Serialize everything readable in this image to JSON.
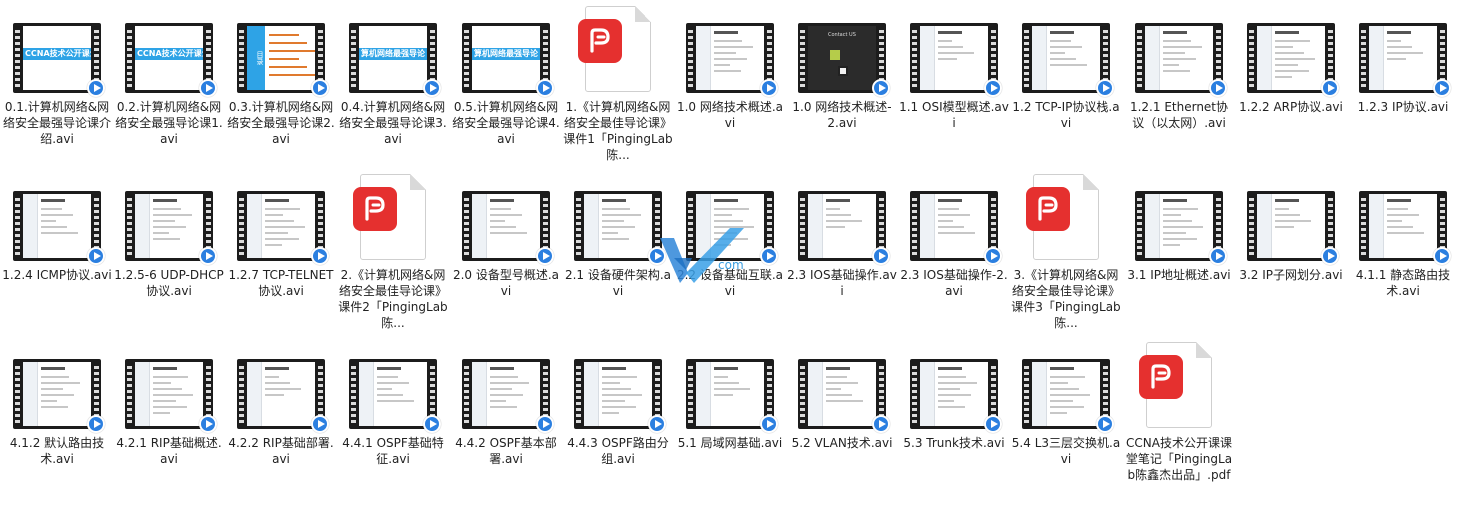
{
  "files": [
    {
      "name": "0.1.计算机网络&网络安全最强导论课介绍.avi",
      "kind": "video",
      "preview": "banner",
      "banner": "CCNA技术公开课介绍"
    },
    {
      "name": "0.2.计算机网络&网络安全最强导论课1.avi",
      "kind": "video",
      "preview": "banner",
      "banner": "CCNA技术公开课介绍"
    },
    {
      "name": "0.3.计算机网络&网络安全最强导论课2.avi",
      "kind": "video",
      "preview": "menu",
      "banner": "目录"
    },
    {
      "name": "0.4.计算机网络&网络安全最强导论课3.avi",
      "kind": "video",
      "preview": "banner",
      "banner": "算机网络最强导论（"
    },
    {
      "name": "0.5.计算机网络&网络安全最强导论课4.avi",
      "kind": "video",
      "preview": "banner",
      "banner": "算机网络最强导论（"
    },
    {
      "name": "1.《计算机网络&网络安全最佳导论课》课件1「PingingLab陈...",
      "kind": "pdf"
    },
    {
      "name": "1.0 网络技术概述.avi",
      "kind": "video",
      "preview": "doc"
    },
    {
      "name": "1.0 网络技术概述-2.avi",
      "kind": "video",
      "preview": "dark",
      "banner": "Contact US"
    },
    {
      "name": "1.1 OSI模型概述.avi",
      "kind": "video",
      "preview": "doc"
    },
    {
      "name": "1.2 TCP-IP协议栈.avi",
      "kind": "video",
      "preview": "doc"
    },
    {
      "name": "1.2.1 Ethernet协议（以太网）.avi",
      "kind": "video",
      "preview": "doc"
    },
    {
      "name": "1.2.2 ARP协议.avi",
      "kind": "video",
      "preview": "doc"
    },
    {
      "name": "1.2.3 IP协议.avi",
      "kind": "video",
      "preview": "doc"
    },
    {
      "name": "1.2.4 ICMP协议.avi",
      "kind": "video",
      "preview": "doc"
    },
    {
      "name": "1.2.5-6 UDP-DHCP协议.avi",
      "kind": "video",
      "preview": "doc"
    },
    {
      "name": "1.2.7 TCP-TELNET协议.avi",
      "kind": "video",
      "preview": "doc"
    },
    {
      "name": "2.《计算机网络&网络安全最佳导论课》课件2「PingingLab陈...",
      "kind": "pdf"
    },
    {
      "name": "2.0 设备型号概述.avi",
      "kind": "video",
      "preview": "doc"
    },
    {
      "name": "2.1 设备硬件架构.avi",
      "kind": "video",
      "preview": "doc"
    },
    {
      "name": "2.2 设备基础互联.avi",
      "kind": "video",
      "preview": "doc"
    },
    {
      "name": "2.3 IOS基础操作.avi",
      "kind": "video",
      "preview": "doc"
    },
    {
      "name": "2.3 IOS基础操作-2.avi",
      "kind": "video",
      "preview": "doc"
    },
    {
      "name": "3.《计算机网络&网络安全最佳导论课》课件3「PingingLab陈...",
      "kind": "pdf"
    },
    {
      "name": "3.1 IP地址概述.avi",
      "kind": "video",
      "preview": "doc"
    },
    {
      "name": "3.2 IP子网划分.avi",
      "kind": "video",
      "preview": "doc"
    },
    {
      "name": "4.1.1 静态路由技术.avi",
      "kind": "video",
      "preview": "doc"
    },
    {
      "name": "4.1.2 默认路由技术.avi",
      "kind": "video",
      "preview": "doc"
    },
    {
      "name": "4.2.1 RIP基础概述.avi",
      "kind": "video",
      "preview": "doc"
    },
    {
      "name": "4.2.2 RIP基础部署.avi",
      "kind": "video",
      "preview": "doc"
    },
    {
      "name": "4.4.1 OSPF基础特征.avi",
      "kind": "video",
      "preview": "doc"
    },
    {
      "name": "4.4.2 OSPF基本部署.avi",
      "kind": "video",
      "preview": "doc"
    },
    {
      "name": "4.4.3 OSPF路由分组.avi",
      "kind": "video",
      "preview": "doc"
    },
    {
      "name": "5.1 局域网基础.avi",
      "kind": "video",
      "preview": "doc"
    },
    {
      "name": "5.2 VLAN技术.avi",
      "kind": "video",
      "preview": "doc"
    },
    {
      "name": "5.3 Trunk技术.avi",
      "kind": "video",
      "preview": "doc"
    },
    {
      "name": "5.4 L3三层交换机.avi",
      "kind": "video",
      "preview": "doc"
    },
    {
      "name": "CCNA技术公开课课堂笔记「PingingLab陈鑫杰出品」.pdf",
      "kind": "pdf"
    }
  ],
  "watermark": {
    "text": "com",
    "icon": "watermark-logo-icon"
  },
  "colors": {
    "pdf_red": "#e5302f",
    "play_blue": "#2b7fe0",
    "banner_blue": "#2ea3e6"
  }
}
